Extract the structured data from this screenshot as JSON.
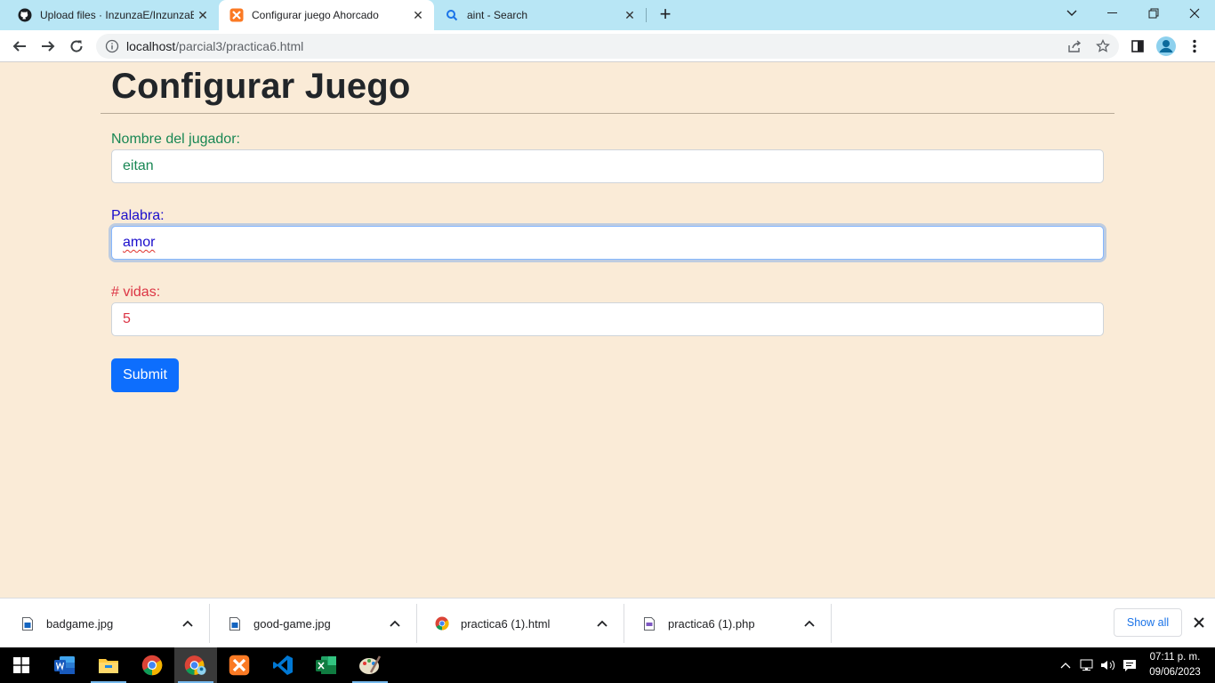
{
  "browser": {
    "tabs": [
      {
        "title": "Upload files · InzunzaE/InzunzaE",
        "icon": "github-icon",
        "active": false
      },
      {
        "title": "Configurar juego Ahorcado",
        "icon": "xampp-icon",
        "active": true
      },
      {
        "title": "aint - Search",
        "icon": "search-icon",
        "active": false
      }
    ],
    "address": {
      "host": "localhost",
      "path": "/parcial3/practica6.html"
    }
  },
  "page": {
    "title": "Configurar Juego",
    "fields": [
      {
        "label": "Nombre del jugador:",
        "value": "eitan",
        "color": "#198754"
      },
      {
        "label": "Palabra:",
        "value": "amor",
        "color": "#1a0dcc"
      },
      {
        "label": "# vidas:",
        "value": "5",
        "color": "#dc3545"
      }
    ],
    "submit_label": "Submit"
  },
  "downloads": {
    "items": [
      {
        "name": "badgame.jpg",
        "icon": "image-file-icon"
      },
      {
        "name": "good-game.jpg",
        "icon": "image-file-icon"
      },
      {
        "name": "practica6 (1).html",
        "icon": "chrome-file-icon"
      },
      {
        "name": "practica6 (1).php",
        "icon": "php-file-icon"
      }
    ],
    "show_all_label": "Show all"
  },
  "taskbar": {
    "apps": [
      "start-icon",
      "word-icon",
      "file-explorer-icon",
      "chrome-icon",
      "chrome-profile-icon",
      "xampp-icon",
      "vscode-icon",
      "excel-icon",
      "paint-icon"
    ],
    "clock": {
      "time": "07:11 p. m.",
      "date": "09/06/2023"
    }
  },
  "colors": {
    "page_bg": "#faebd7",
    "tabstrip_bg": "#b8e6f5",
    "submit_bg": "#0d6efd"
  }
}
